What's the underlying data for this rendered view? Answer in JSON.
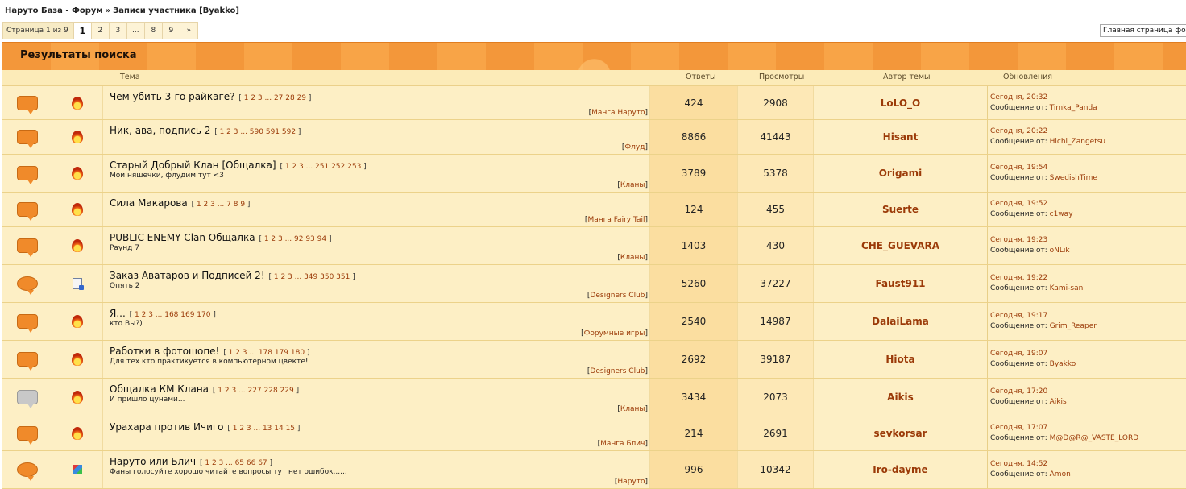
{
  "breadcrumb": {
    "forum": "Наруто База - Форум",
    "separator": "»",
    "current": "Записи участника [Byakko]"
  },
  "pager": {
    "label": "Страница 1 из 9",
    "pages": [
      "1",
      "2",
      "3",
      "...",
      "8",
      "9",
      "»"
    ],
    "current": "1"
  },
  "jump": {
    "value": "Главная страница форума"
  },
  "section": {
    "title": "Результаты поиска"
  },
  "columns": {
    "topic": "Тема",
    "replies": "Ответы",
    "views": "Просмотры",
    "author": "Автор темы",
    "updates": "Обновления"
  },
  "rows": [
    {
      "title": "Чем убить 3-го райкаге?",
      "pages": "1 2 3 ... 27 28 29",
      "desc": "",
      "forum": "Манга Наруто",
      "replies": "424",
      "views": "2908",
      "author": "LoLO_O",
      "date": "Сегодня, 20:32",
      "by_label": "Сообщение от:",
      "by": "Timka_Panda",
      "icon": "bubble-orange",
      "flag": "fire-icon"
    },
    {
      "title": "Ник, ава, подпись 2",
      "pages": "1 2 3 ... 590 591 592",
      "desc": "",
      "forum": "Флуд",
      "replies": "8866",
      "views": "41443",
      "author": "Hisant",
      "date": "Сегодня, 20:22",
      "by_label": "Сообщение от:",
      "by": "Hichi_Zangetsu",
      "icon": "bubble-orange",
      "flag": "fire-icon"
    },
    {
      "title": "Старый Добрый Клан [Общалка]",
      "pages": "1 2 3 ... 251 252 253",
      "desc": "Мои няшечки, флудим тут <3",
      "forum": "Кланы",
      "replies": "3789",
      "views": "5378",
      "author": "Origami",
      "date": "Сегодня, 19:54",
      "by_label": "Сообщение от:",
      "by": "SwedishTime",
      "icon": "bubble-orange",
      "flag": "fire-icon"
    },
    {
      "title": "Сила Макарова",
      "pages": "1 2 3 ... 7 8 9",
      "desc": "",
      "forum": "Манга Fairy Tail",
      "replies": "124",
      "views": "455",
      "author": "Suerte",
      "date": "Сегодня, 19:52",
      "by_label": "Сообщение от:",
      "by": "c1way",
      "icon": "bubble-orange",
      "flag": "fire-icon"
    },
    {
      "title": "PUBLIC ENEMY Clan Общалка",
      "pages": "1 2 3 ... 92 93 94",
      "desc": "Раунд 7",
      "forum": "Кланы",
      "replies": "1403",
      "views": "430",
      "author": "CHE_GUEVARA",
      "date": "Сегодня, 19:23",
      "by_label": "Сообщение от:",
      "by": "oNLik",
      "icon": "bubble-orange",
      "flag": "fire-icon"
    },
    {
      "title": "Заказ Аватаров и Подписей 2!",
      "pages": "1 2 3 ... 349 350 351",
      "desc": "Опять 2",
      "forum": "Designers Club",
      "replies": "5260",
      "views": "37227",
      "author": "Faust911",
      "date": "Сегодня, 19:22",
      "by_label": "Сообщение от:",
      "by": "Kami-san",
      "icon": "bubble-cloud",
      "flag": "doc-icon"
    },
    {
      "title": "Я...",
      "pages": "1 2 3 ... 168 169 170",
      "desc": "кто Вы?)",
      "forum": "Форумные игры",
      "replies": "2540",
      "views": "14987",
      "author": "DalaiLama",
      "date": "Сегодня, 19:17",
      "by_label": "Сообщение от:",
      "by": "Grim_Reaper",
      "icon": "bubble-orange",
      "flag": "fire-icon"
    },
    {
      "title": "Работки в фотошопе!",
      "pages": "1 2 3 ... 178 179 180",
      "desc": "Для тех кто практикуется в компьютерном цвекте!",
      "forum": "Designers Club",
      "replies": "2692",
      "views": "39187",
      "author": "Hiota",
      "date": "Сегодня, 19:07",
      "by_label": "Сообщение от:",
      "by": "Byakko",
      "icon": "bubble-orange",
      "flag": "fire-icon"
    },
    {
      "title": "Общалка КМ Клана",
      "pages": "1 2 3 ... 227 228 229",
      "desc": "И пришло цунами...",
      "forum": "Кланы",
      "replies": "3434",
      "views": "2073",
      "author": "Aikis",
      "date": "Сегодня, 17:20",
      "by_label": "Сообщение от:",
      "by": "Aikis",
      "icon": "bubble-gray",
      "flag": "fire-icon"
    },
    {
      "title": "Урахара против Ичиго",
      "pages": "1 2 3 ... 13 14 15",
      "desc": "",
      "forum": "Манга Блич",
      "replies": "214",
      "views": "2691",
      "author": "sevkorsar",
      "date": "Сегодня, 17:07",
      "by_label": "Сообщение от:",
      "by": "M@D@R@_VASTE_LORD",
      "icon": "bubble-orange",
      "flag": "fire-icon"
    },
    {
      "title": "Наруто или Блич",
      "pages": "1 2 3 ... 65 66 67",
      "desc": "Фаны голосуйте хорошо читайте вопросы тут нет ошибок......",
      "forum": "Наруто",
      "replies": "996",
      "views": "10342",
      "author": "Iro-dayme",
      "date": "Сегодня, 14:52",
      "by_label": "Сообщение от:",
      "by": "Amon",
      "icon": "bubble-cloud",
      "flag": "cube-icon"
    }
  ],
  "colors": {
    "accent": "#f69d3e",
    "link": "#9b3a08",
    "row_bg": "#fdefc5"
  }
}
